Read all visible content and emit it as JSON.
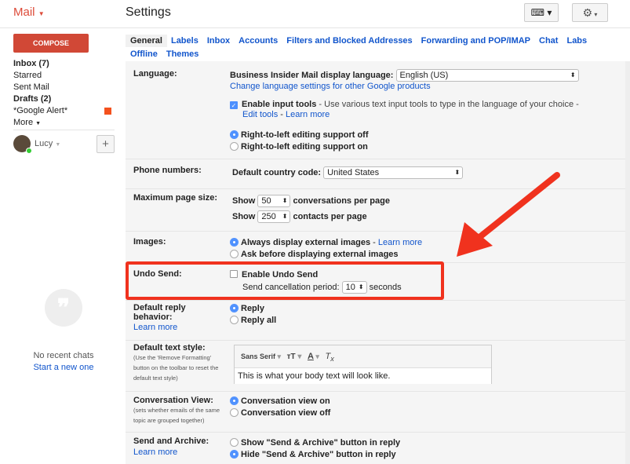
{
  "header": {
    "app": "Mail",
    "title": "Settings"
  },
  "sidebar": {
    "compose": "COMPOSE",
    "items": [
      {
        "label": "Inbox (7)",
        "bold": true
      },
      {
        "label": "Starred"
      },
      {
        "label": "Sent Mail"
      },
      {
        "label": "Drafts (2)",
        "bold": true
      },
      {
        "label": "*Google Alert*"
      },
      {
        "label": "More"
      }
    ],
    "label_color": "#f4511e",
    "user": "Lucy",
    "no_chats": "No recent chats",
    "start_chat": "Start a new one"
  },
  "tabs": [
    "General",
    "Labels",
    "Inbox",
    "Accounts",
    "Filters and Blocked Addresses",
    "Forwarding and POP/IMAP",
    "Chat",
    "Labs",
    "Offline",
    "Themes"
  ],
  "settings": {
    "language": {
      "label": "Language:",
      "display_label": "Business Insider Mail display language:",
      "value": "English (US)",
      "change_link": "Change language settings for other Google products",
      "input_tools": "Enable input tools",
      "input_tools_desc": " - Use various text input tools to type in the language of your choice -",
      "edit_tools": "Edit tools",
      "learn_more": "Learn more",
      "rtl_off": "Right-to-left editing support off",
      "rtl_on": "Right-to-left editing support on"
    },
    "phone": {
      "label": "Phone numbers:",
      "country_label": "Default country code:",
      "value": "United States"
    },
    "page_size": {
      "label": "Maximum page size:",
      "show": "Show",
      "conv_value": "50",
      "conv_suffix": "conversations per page",
      "contacts_value": "250",
      "contacts_suffix": "contacts per page"
    },
    "images": {
      "label": "Images:",
      "always": "Always display external images",
      "learn_more": "Learn more",
      "ask": "Ask before displaying external images"
    },
    "undo": {
      "label": "Undo Send:",
      "enable": "Enable Undo Send",
      "period_label": "Send cancellation period:",
      "value": "10",
      "suffix": "seconds"
    },
    "reply": {
      "label": "Default reply behavior:",
      "learn_more": "Learn more",
      "reply": "Reply",
      "reply_all": "Reply all"
    },
    "text_style": {
      "label": "Default text style:",
      "sub": "(Use the 'Remove Formatting' button on the toolbar to reset the default text style)",
      "font": "Sans Serif",
      "preview": "This is what your body text will look like."
    },
    "conversation": {
      "label": "Conversation View:",
      "sub": "(sets whether emails of the same topic are grouped together)",
      "on": "Conversation view on",
      "off": "Conversation view off"
    },
    "send_archive": {
      "label": "Send and Archive:",
      "learn_more": "Learn more",
      "show": "Show \"Send & Archive\" button in reply",
      "hide": "Hide \"Send & Archive\" button in reply"
    }
  },
  "highlight_color": "#f0321e"
}
